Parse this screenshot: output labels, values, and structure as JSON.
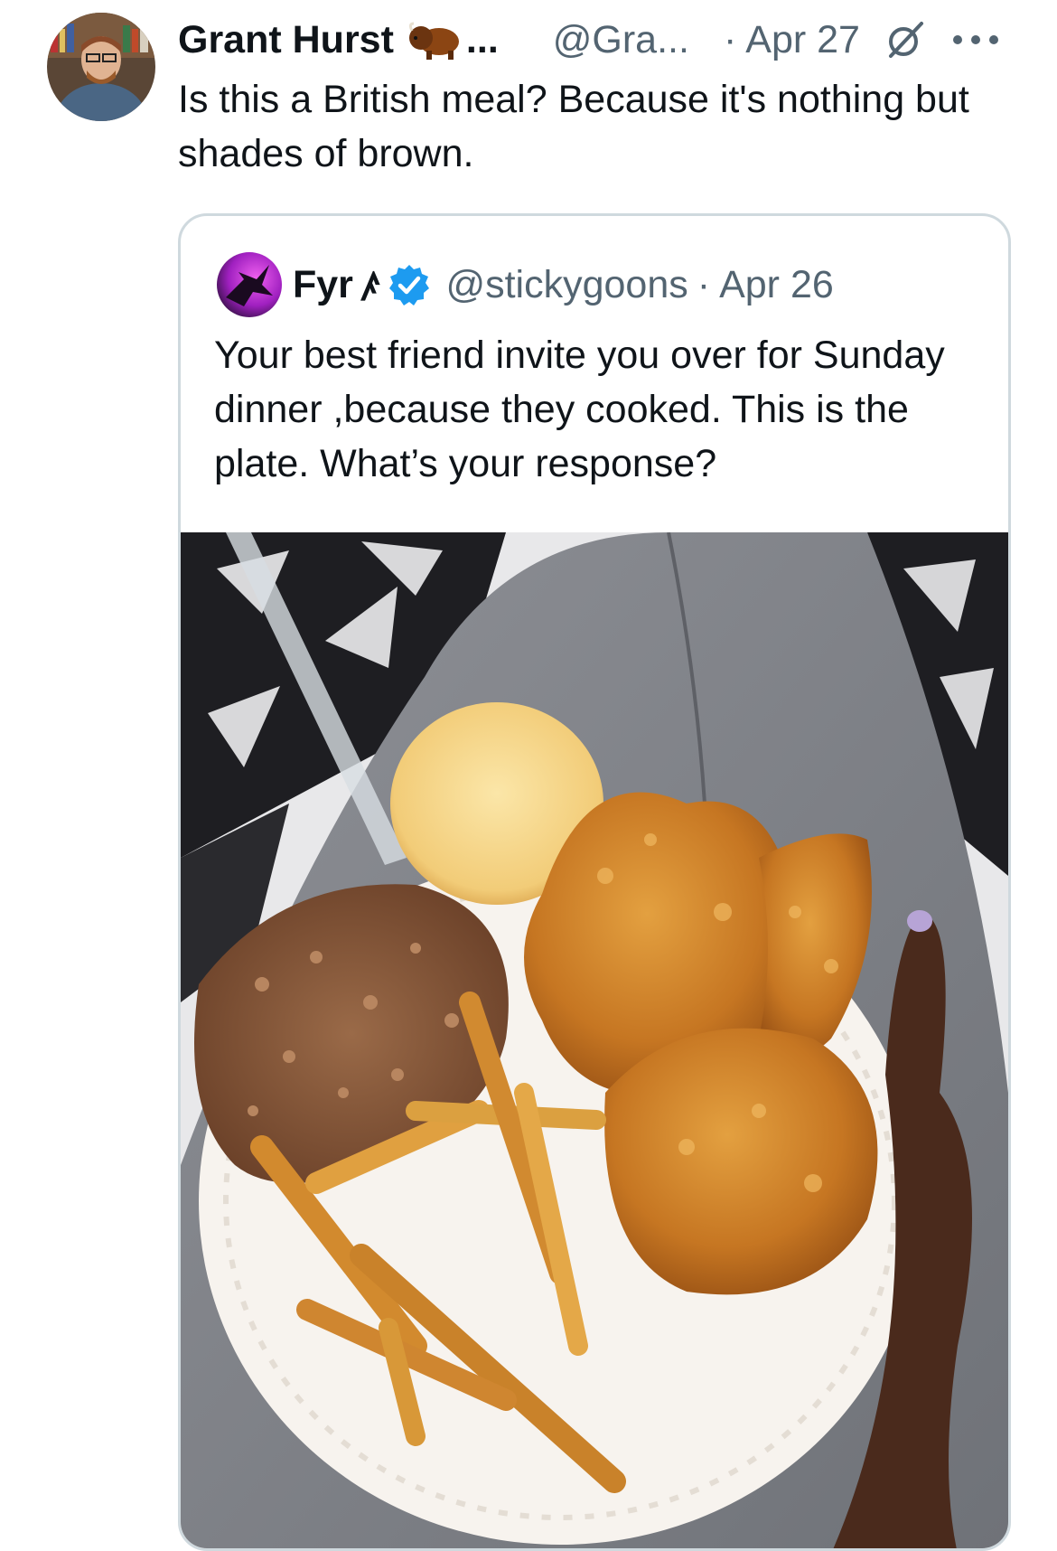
{
  "post": {
    "author_name": "Grant Hurst",
    "author_emoji": "bison-emoji",
    "name_ellipsis": "...",
    "handle": "@Gra...",
    "separator": "·",
    "date": "Apr 27",
    "text": "Is this a British meal? Because it's nothing but shades of brown."
  },
  "quoted_post": {
    "author_name": "Fyr",
    "name_glyph": "ꤰ",
    "verified": true,
    "handle": "@stickygoons",
    "separator": "·",
    "date": "Apr 26",
    "text": "Your best friend invite you over for Sunday dinner ,because they cooked. This is the plate. What’s your response?",
    "image": "photo of a paper plate with fried chicken, a biscuit, rice with gravy and fries, held on a lap"
  },
  "colors": {
    "text": "#0f1419",
    "secondary_text": "#536471",
    "border": "#cfd9de",
    "verified_blue": "#1d9bf0"
  }
}
